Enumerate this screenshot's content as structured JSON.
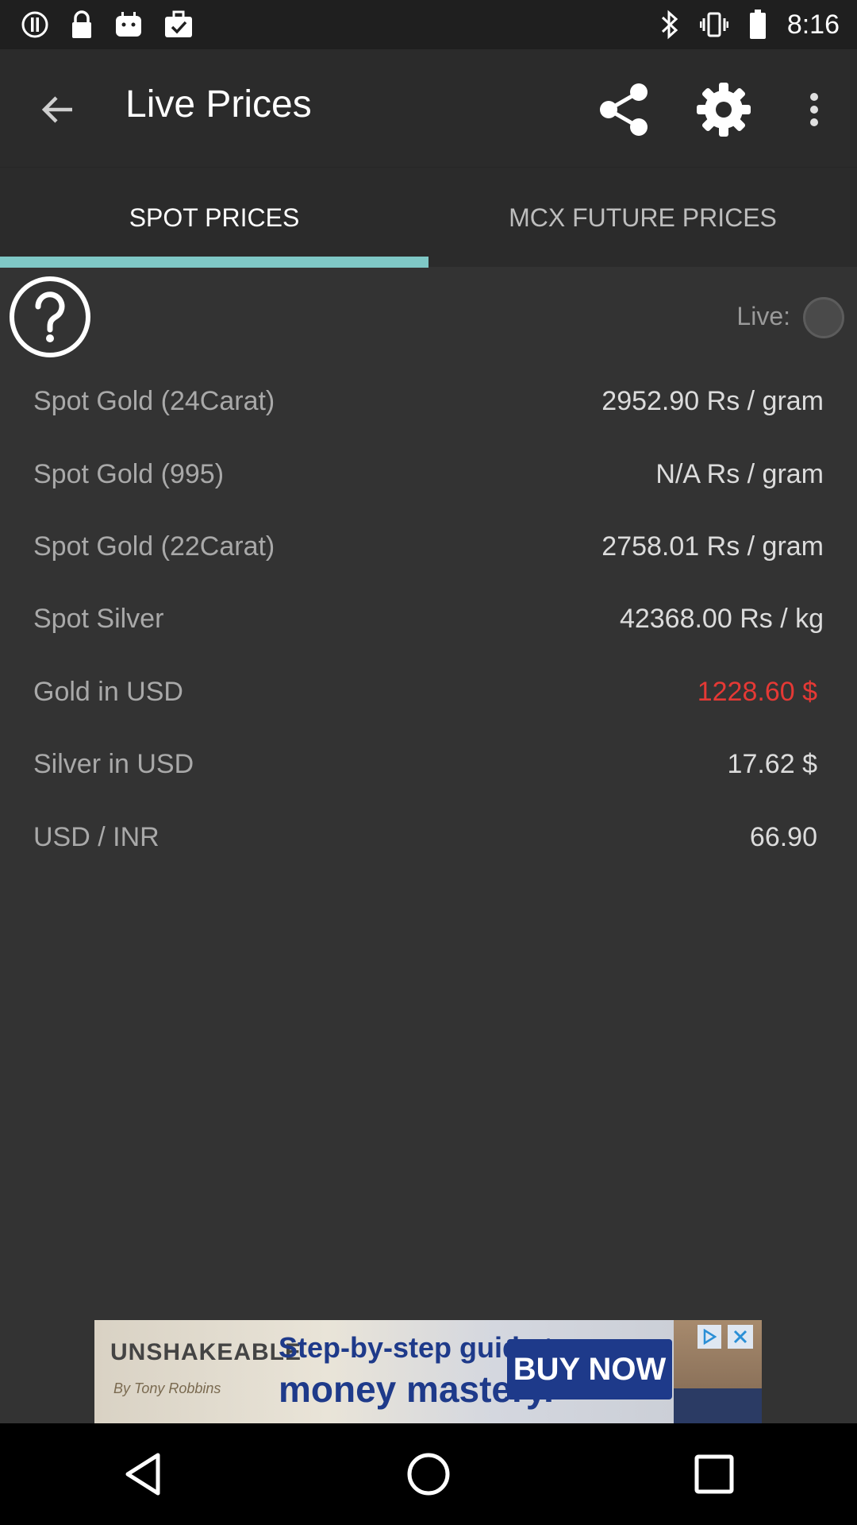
{
  "status_bar": {
    "time": "8:16"
  },
  "app_bar": {
    "title": "Live Prices"
  },
  "tabs": [
    {
      "label": "SPOT PRICES",
      "active": true
    },
    {
      "label": "MCX FUTURE PRICES",
      "active": false
    }
  ],
  "live": {
    "label": "Live:",
    "enabled": false
  },
  "prices": [
    {
      "label": "Spot Gold (24Carat)",
      "value": "2952.90  Rs / gram"
    },
    {
      "label": "Spot Gold (995)",
      "value": "N/A  Rs / gram"
    },
    {
      "label": "Spot Gold (22Carat)",
      "value": "2758.01  Rs / gram"
    },
    {
      "label": "Spot Silver",
      "value": "42368.00  Rs / kg"
    },
    {
      "label": "Gold in USD",
      "value": "1228.60  $"
    },
    {
      "label": "Silver in USD",
      "value": "17.62  $"
    },
    {
      "label": "USD / INR",
      "value": "66.90"
    }
  ],
  "ad": {
    "brand": "UNSHAKEABLE",
    "brand_sub": "By Tony Robbins",
    "line1": "Step-by-step guide to",
    "line2": "money mastery.",
    "cta": "BUY NOW"
  },
  "colors": {
    "accent": "#7fc8c6",
    "alert_red": "#e53935",
    "background": "#333333",
    "app_bar": "#2b2b2b"
  }
}
